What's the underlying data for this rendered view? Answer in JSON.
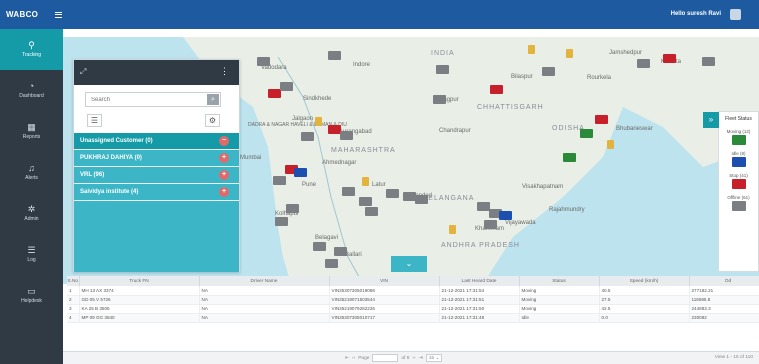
{
  "app": {
    "brand": "WABCO",
    "greeting": "Hello suresh Ravi"
  },
  "sidebar": {
    "items": [
      {
        "label": "Tracking",
        "icon": "map-pin-icon"
      },
      {
        "label": "Dashboard",
        "icon": "gauge-icon"
      },
      {
        "label": "Reports",
        "icon": "table-icon"
      },
      {
        "label": "Alerts",
        "icon": "bell-icon"
      },
      {
        "label": "Admin",
        "icon": "gear-icon"
      },
      {
        "label": "Log",
        "icon": "list-icon"
      },
      {
        "label": "Helpdesk",
        "icon": "monitor-icon"
      }
    ]
  },
  "panel": {
    "search_placeholder": "Search",
    "groups": [
      {
        "label": "Unassigned Customer (0)",
        "toggle": "−"
      },
      {
        "label": "PUKHRAJ DAHIYA (0)",
        "toggle": "+"
      },
      {
        "label": "VRL (96)",
        "toggle": "+"
      },
      {
        "label": "Saividya institute (4)",
        "toggle": "+"
      }
    ]
  },
  "map": {
    "labels": [
      "Vadodara",
      "Indore",
      "INDIA",
      "Jamshedpur",
      "Kolkata",
      "Bilaspur",
      "Rourkela",
      "Bhubaneswar",
      "Nagpur",
      "CHHATTISGARH",
      "Sindkhede",
      "Jalgaon",
      "Aurangabad",
      "MAHARASHTRA",
      "Chandrapur",
      "ODISHA",
      "Mumbai",
      "Ahmednagar",
      "Pune",
      "Latur",
      "Nanded",
      "TELANGANA",
      "Visakhapatnam",
      "Kolhapur",
      "Belagavi",
      "Vijayawada",
      "ANDHRA PRADESH",
      "Ballari",
      "DADRA & NAGAR HAVELI & DAMAN & DIU",
      "Rajahmundry",
      "Khammam"
    ]
  },
  "fleet": {
    "title": "Fleet Status",
    "statuses": [
      {
        "label": "Moving (12)",
        "color": "#2a8a3a"
      },
      {
        "label": "Idle (8)",
        "color": "#1d4fb0"
      },
      {
        "label": "Stop (41)",
        "color": "#c8202a"
      },
      {
        "label": "Offline (61)",
        "color": "#7b7f84"
      }
    ]
  },
  "table": {
    "columns": [
      "S.No",
      "Truck FN",
      "Driver Name",
      "VIN",
      "Last Heard Date",
      "Status",
      "Speed (km/h)",
      "Od"
    ],
    "rows": [
      [
        "1",
        "MH 13 AX 3374",
        "NA",
        "VIN35307305019086",
        "21-12-2021 17:31:54",
        "Moving",
        "40.5",
        "277182.21"
      ],
      [
        "2",
        "GD 05 V 5726",
        "NA",
        "VIN35219071503544",
        "21-12-2021 17:31:51",
        "Moving",
        "27.5",
        "116595.8"
      ],
      [
        "3",
        "KA 25 B 3506",
        "NA",
        "VIN35219079282226",
        "21-12-2021 17:31:50",
        "Moving",
        "42.5",
        "244883.3"
      ],
      [
        "4",
        "MP 09 GG 3840",
        "NA",
        "VIN35307305010717",
        "21-12-2021 17:31:48",
        "Idle",
        "0.0",
        "230082"
      ]
    ]
  },
  "pager": {
    "page_label": "Page",
    "of_label": "of 8",
    "page_size": "15",
    "view_text": "View 1 - 15 of 110"
  }
}
